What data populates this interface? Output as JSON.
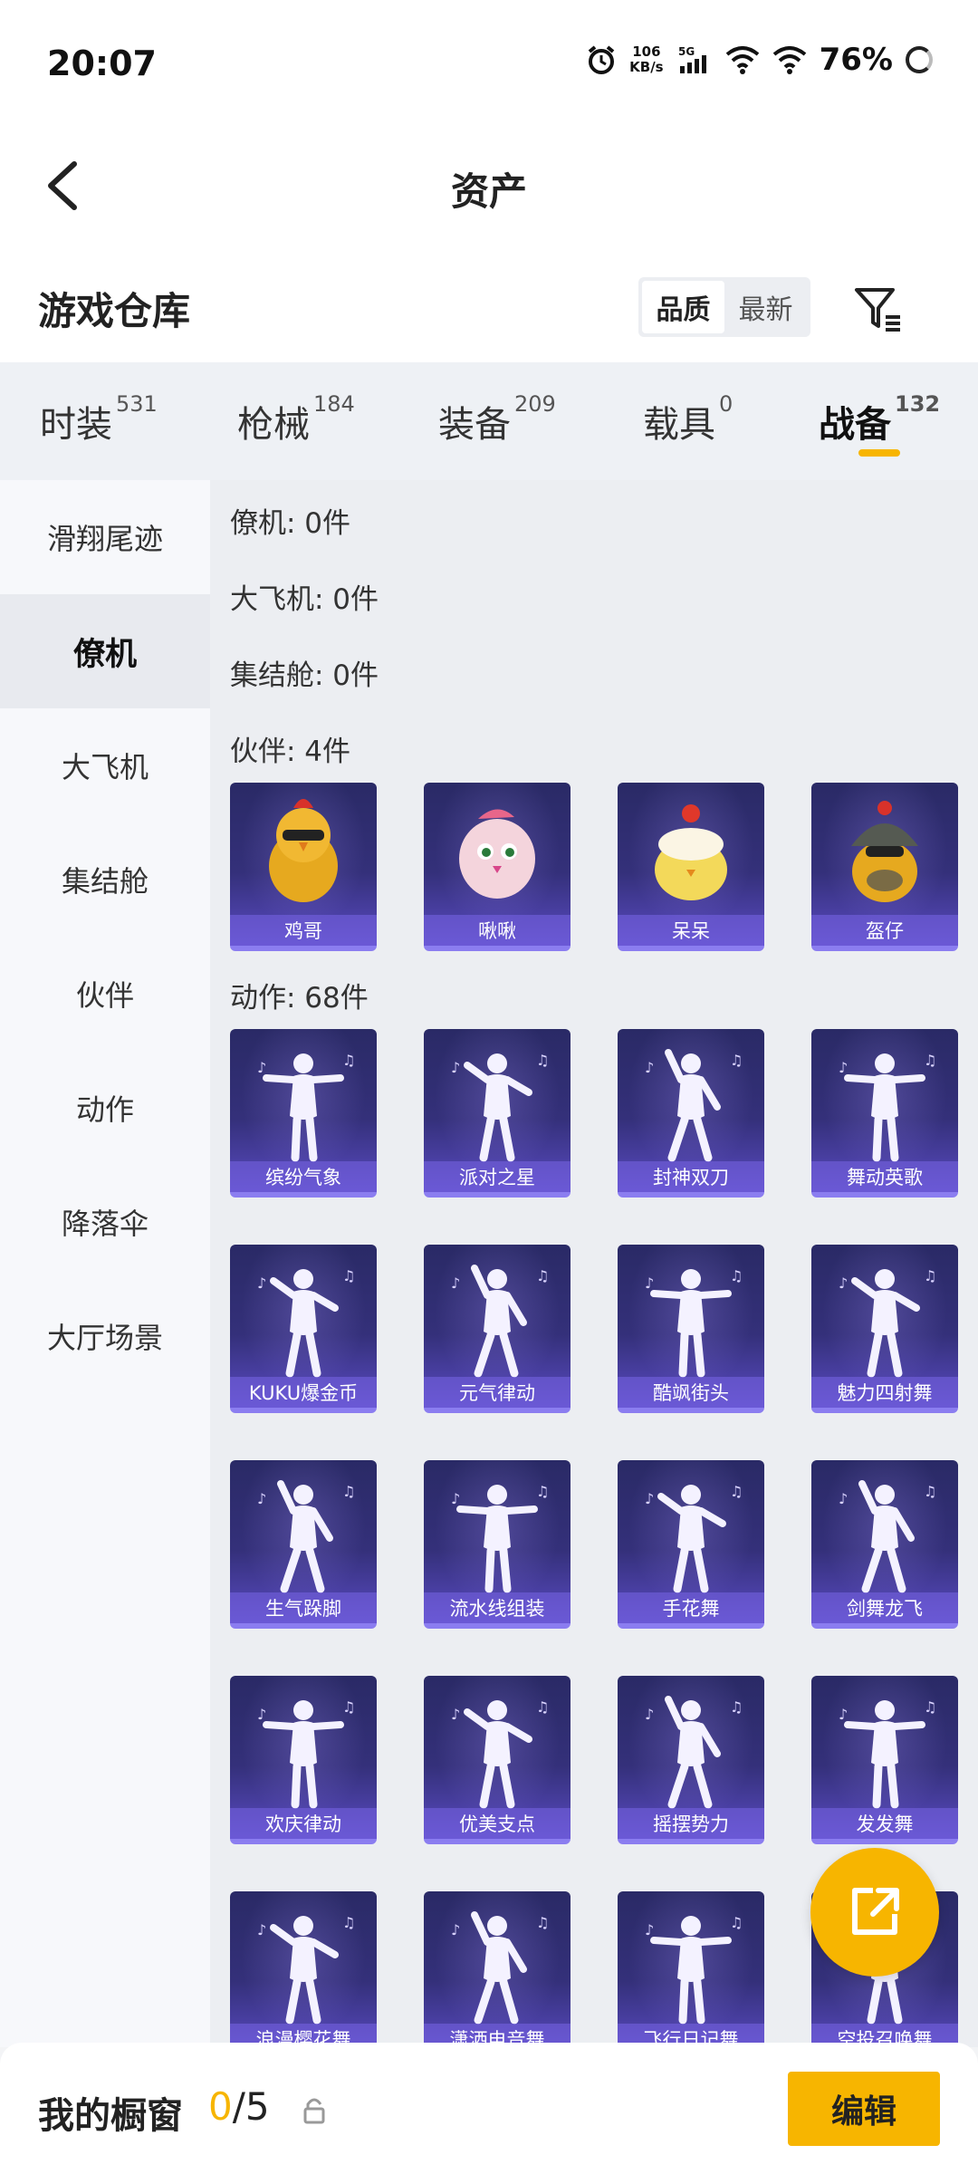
{
  "status": {
    "time": "20:07",
    "net_speed_value": "106",
    "net_speed_unit": "KB/s",
    "network": "5G",
    "battery": "76%"
  },
  "header": {
    "title": "资产"
  },
  "warehouse": {
    "title": "游戏仓库",
    "sort_options": [
      "品质",
      "最新"
    ],
    "sort_selected": "品质"
  },
  "tabs": [
    {
      "label": "时装",
      "count": "531"
    },
    {
      "label": "枪械",
      "count": "184"
    },
    {
      "label": "装备",
      "count": "209"
    },
    {
      "label": "载具",
      "count": "0"
    },
    {
      "label": "战备",
      "count": "132",
      "active": true
    }
  ],
  "sidebar": {
    "items": [
      "滑翔尾迹",
      "僚机",
      "大飞机",
      "集结舱",
      "伙伴",
      "动作",
      "降落伞",
      "大厅场景"
    ],
    "active": "僚机"
  },
  "content": {
    "sections": {
      "wingman": "僚机: 0件",
      "big_plane": "大飞机: 0件",
      "pod": "集结舱: 0件",
      "partner": "伙伴: 4件",
      "action": "动作: 68件"
    },
    "partners": [
      "鸡哥",
      "啾啾",
      "呆呆",
      "盔仔"
    ],
    "actions": [
      "缤纷气象",
      "派对之星",
      "封神双刀",
      "舞动英歌",
      "KUKU爆金币",
      "元气律动",
      "酷飒街头",
      "魅力四射舞",
      "生气跺脚",
      "流水线组装",
      "手花舞",
      "剑舞龙飞",
      "欢庆律动",
      "优美支点",
      "摇摆势力",
      "发发舞",
      "浪漫樱花舞",
      "潇洒电音舞",
      "飞行日记舞",
      "空投召唤舞"
    ]
  },
  "bottom": {
    "label": "我的橱窗",
    "current": "0",
    "total": "/5",
    "edit_label": "编辑"
  },
  "colors": {
    "accent": "#f7b500",
    "card_top": "#2a2a66",
    "card_bottom": "#5a4bc2"
  }
}
